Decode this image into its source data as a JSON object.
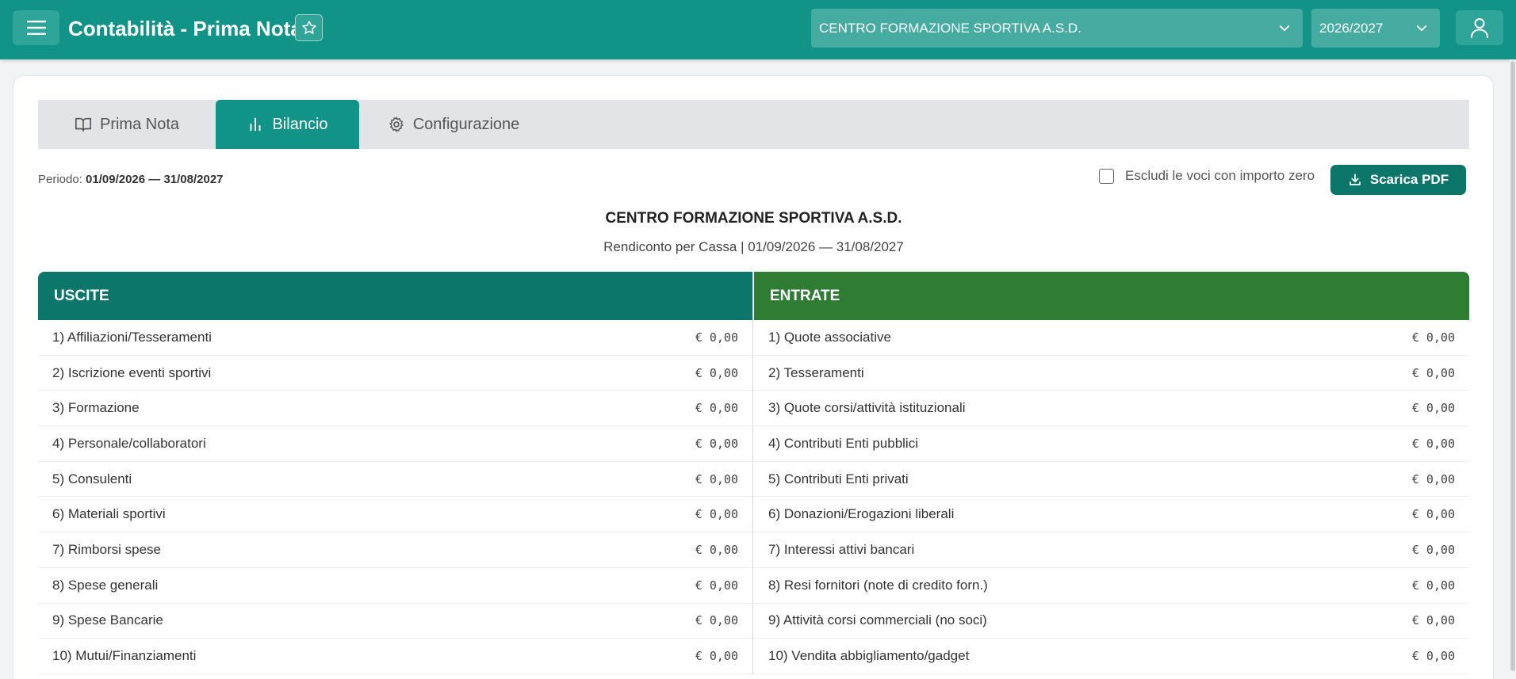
{
  "header": {
    "title": "Contabilità - Prima Nota",
    "organization": "CENTRO FORMAZIONE SPORTIVA A.S.D.",
    "year": "2026/2027",
    "colors": {
      "primary": "#119487",
      "dark": "#0d766b",
      "green": "#2e7d32"
    }
  },
  "tabs": [
    {
      "label": "Prima Nota",
      "icon": "book-open-icon",
      "active": false
    },
    {
      "label": "Bilancio",
      "icon": "bar-chart-icon",
      "active": true
    },
    {
      "label": "Configurazione",
      "icon": "gear-icon",
      "active": false
    }
  ],
  "toolbar": {
    "period_label": "Periodo:",
    "period_value": "01/09/2026 — 31/08/2027",
    "exclude_label": "Escludi le voci con importo zero",
    "exclude_checked": false,
    "pdf_label": "Scarica PDF"
  },
  "report": {
    "title": "CENTRO FORMAZIONE SPORTIVA A.S.D.",
    "subtitle": "Rendiconto per Cassa  |  01/09/2026 — 31/08/2027"
  },
  "uscite": {
    "header": "USCITE",
    "rows": [
      {
        "label": "1) Affiliazioni/Tesseramenti",
        "amount": "€ 0,00"
      },
      {
        "label": "2) Iscrizione eventi sportivi",
        "amount": "€ 0,00"
      },
      {
        "label": "3) Formazione",
        "amount": "€ 0,00"
      },
      {
        "label": "4) Personale/collaboratori",
        "amount": "€ 0,00"
      },
      {
        "label": "5) Consulenti",
        "amount": "€ 0,00"
      },
      {
        "label": "6) Materiali sportivi",
        "amount": "€ 0,00"
      },
      {
        "label": "7) Rimborsi spese",
        "amount": "€ 0,00"
      },
      {
        "label": "8) Spese generali",
        "amount": "€ 0,00"
      },
      {
        "label": "9) Spese Bancarie",
        "amount": "€ 0,00"
      },
      {
        "label": "10) Mutui/Finanziamenti",
        "amount": "€ 0,00"
      }
    ]
  },
  "entrate": {
    "header": "ENTRATE",
    "rows": [
      {
        "label": "1) Quote associative",
        "amount": "€ 0,00"
      },
      {
        "label": "2) Tesseramenti",
        "amount": "€ 0,00"
      },
      {
        "label": "3) Quote corsi/attività istituzionali",
        "amount": "€ 0,00"
      },
      {
        "label": "4) Contributi Enti pubblici",
        "amount": "€ 0,00"
      },
      {
        "label": "5) Contributi Enti privati",
        "amount": "€ 0,00"
      },
      {
        "label": "6) Donazioni/Erogazioni liberali",
        "amount": "€ 0,00"
      },
      {
        "label": "7) Interessi attivi bancari",
        "amount": "€ 0,00"
      },
      {
        "label": "8) Resi fornitori (note di credito forn.)",
        "amount": "€ 0,00"
      },
      {
        "label": "9) Attività corsi commerciali (no soci)",
        "amount": "€ 0,00"
      },
      {
        "label": "10) Vendita abbigliamento/gadget",
        "amount": "€ 0,00"
      }
    ]
  }
}
